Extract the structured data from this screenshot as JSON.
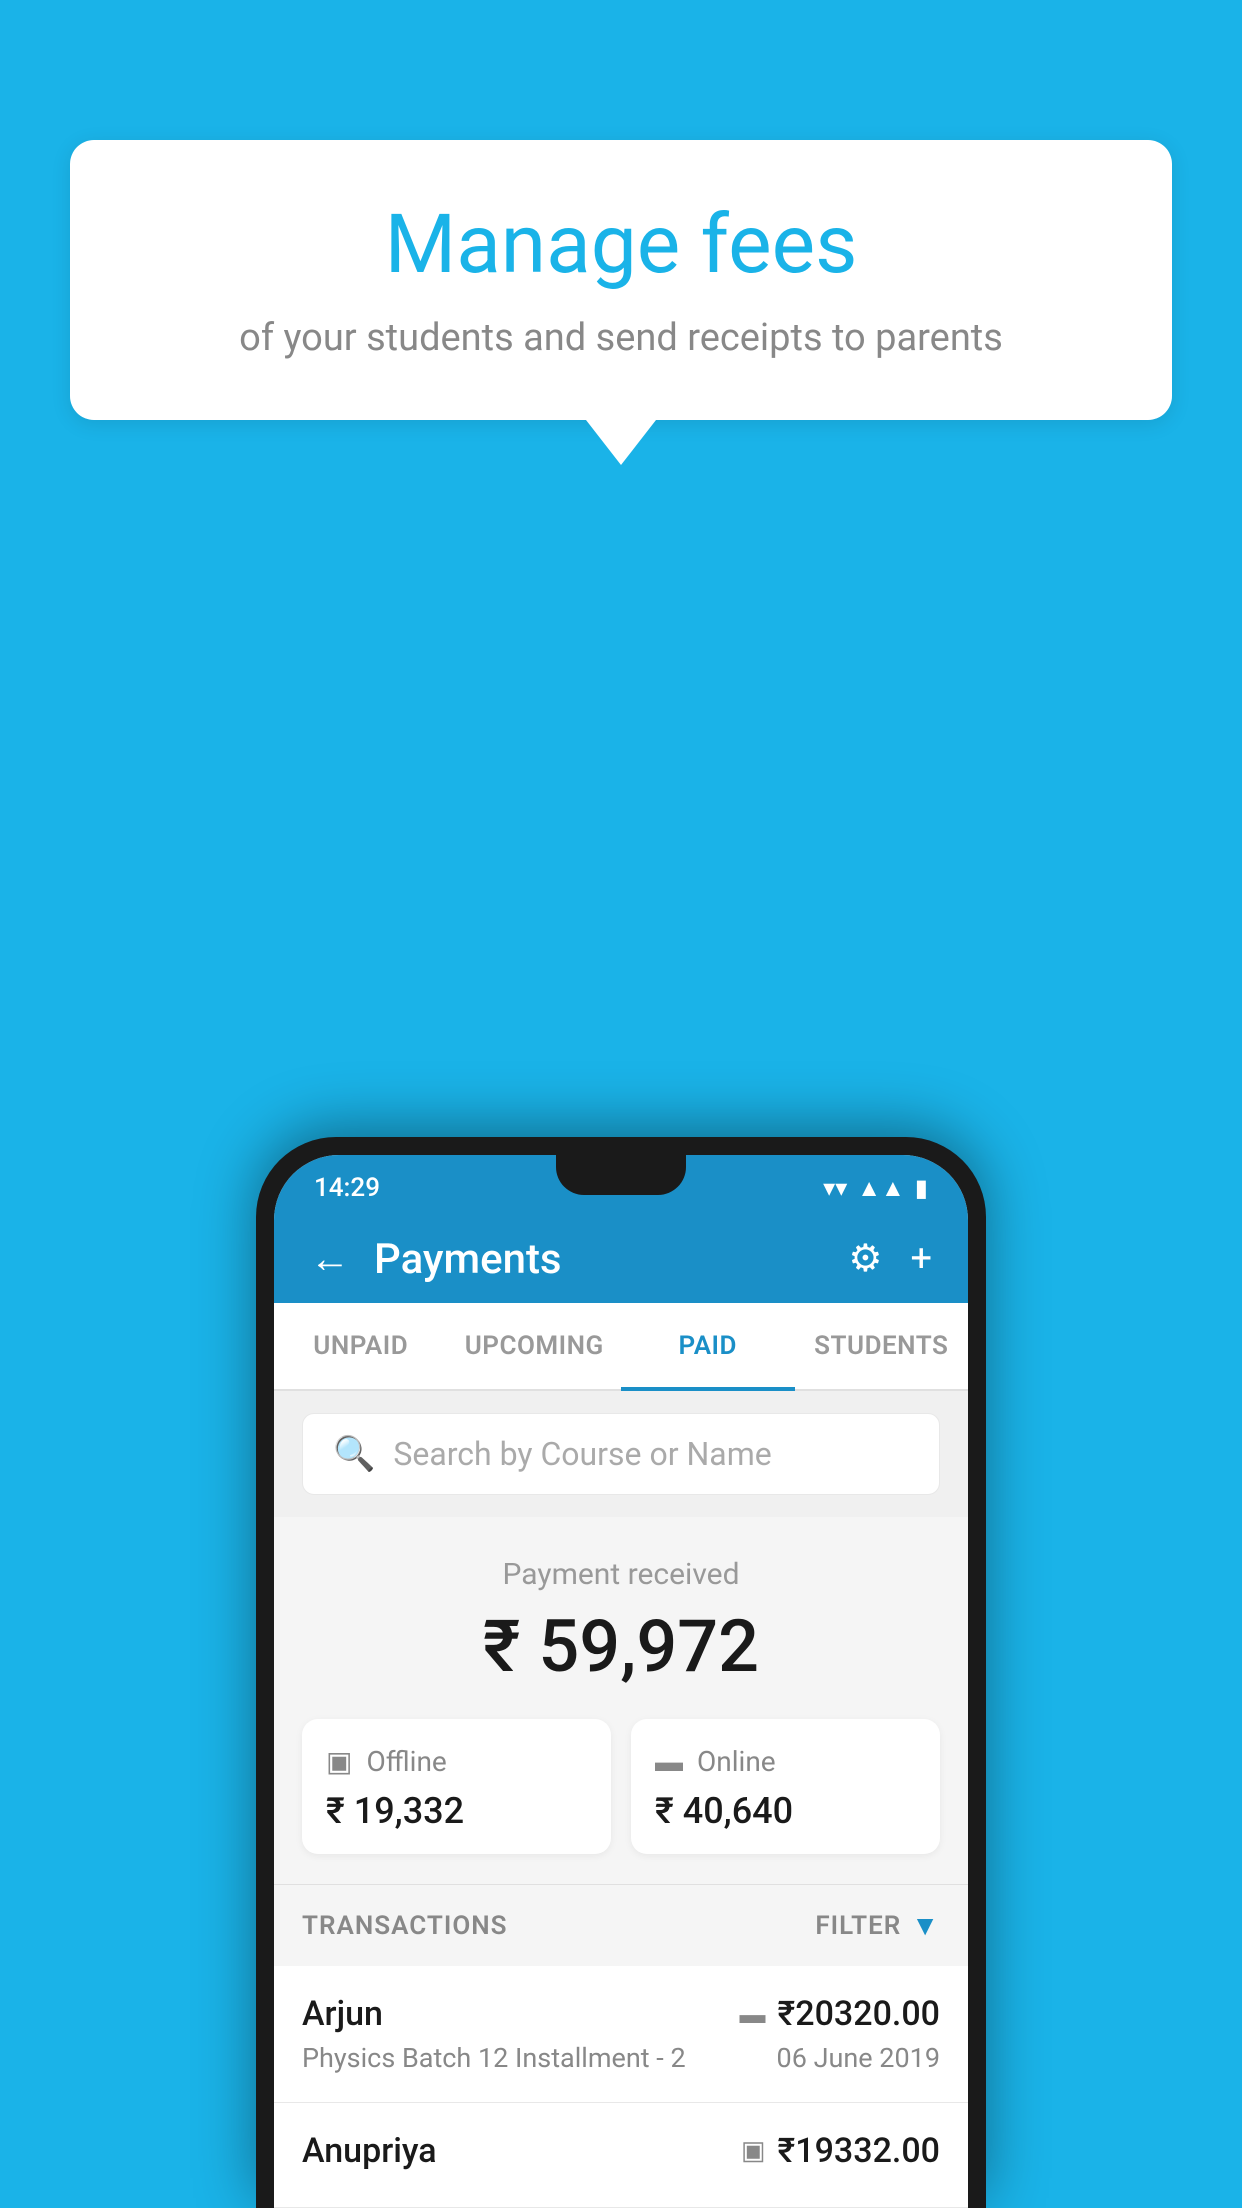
{
  "background_color": "#1ab3e8",
  "speech_bubble": {
    "title": "Manage fees",
    "subtitle": "of your students and send receipts to parents"
  },
  "status_bar": {
    "time": "14:29",
    "wifi": "▼",
    "signal": "▲",
    "battery": "▮"
  },
  "header": {
    "title": "Payments",
    "back_label": "←",
    "gear_label": "⚙",
    "plus_label": "+"
  },
  "tabs": [
    {
      "label": "UNPAID",
      "active": false
    },
    {
      "label": "UPCOMING",
      "active": false
    },
    {
      "label": "PAID",
      "active": true
    },
    {
      "label": "STUDENTS",
      "active": false
    }
  ],
  "search": {
    "placeholder": "Search by Course or Name"
  },
  "payment_summary": {
    "label": "Payment received",
    "total": "₹ 59,972",
    "offline": {
      "type": "Offline",
      "amount": "₹ 19,332"
    },
    "online": {
      "type": "Online",
      "amount": "₹ 40,640"
    }
  },
  "transactions": {
    "label": "TRANSACTIONS",
    "filter_label": "FILTER",
    "items": [
      {
        "name": "Arjun",
        "course": "Physics Batch 12 Installment - 2",
        "amount": "₹20320.00",
        "date": "06 June 2019",
        "type": "online"
      },
      {
        "name": "Anupriya",
        "course": "",
        "amount": "₹19332.00",
        "date": "",
        "type": "offline"
      }
    ]
  }
}
